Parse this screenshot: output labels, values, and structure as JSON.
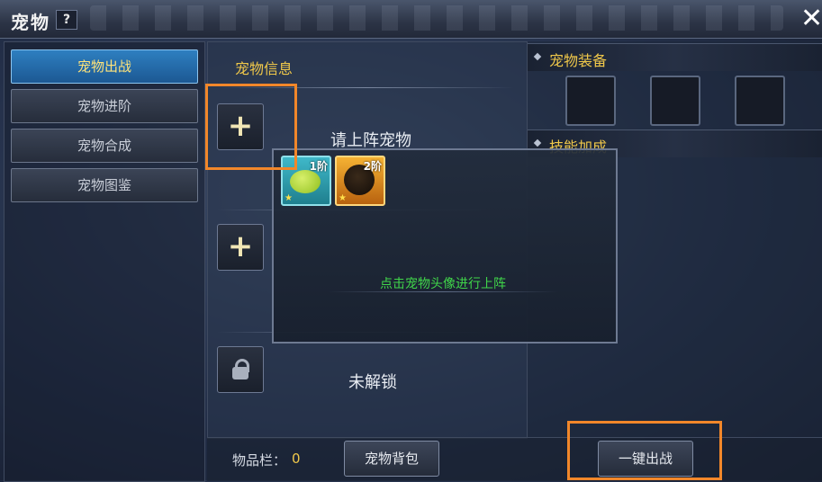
{
  "window": {
    "title": "宠物",
    "help_label": "?",
    "close_label": "✕"
  },
  "sidebar": {
    "items": [
      {
        "label": "宠物出战",
        "active": true
      },
      {
        "label": "宠物进阶",
        "active": false
      },
      {
        "label": "宠物合成",
        "active": false
      },
      {
        "label": "宠物图鉴",
        "active": false
      }
    ]
  },
  "pet_info": {
    "title": "宠物信息",
    "slot1_label": "请上阵宠物",
    "slot3_label": "未解锁",
    "add_symbol": "+"
  },
  "equipment": {
    "title": "宠物装备"
  },
  "skills": {
    "title": "技能加成"
  },
  "popup": {
    "pets": [
      {
        "name": "green-slime-pet",
        "rank": "1阶",
        "stars": "★"
      },
      {
        "name": "black-beast-pet",
        "rank": "2阶",
        "stars": "★"
      }
    ],
    "hint": "点击宠物头像进行上阵"
  },
  "footer": {
    "inventory_label": "物品栏：",
    "inventory_count": "0",
    "bag_button": "宠物背包",
    "deploy_button": "一键出战"
  },
  "colors": {
    "accent_gold": "#f0c84a",
    "active_tab": "#2e7fc0",
    "hint_green": "#40d64a",
    "highlight": "#f2872a"
  }
}
